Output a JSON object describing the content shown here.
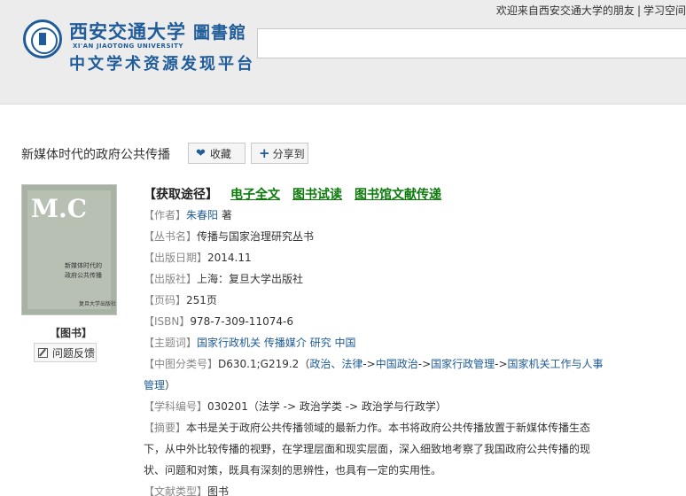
{
  "header": {
    "logo_cn": "西安交通大学",
    "logo_lib": "圖書館",
    "logo_en": "XI'AN JIAOTONG UNIVERSITY",
    "logo_sub": "中文学术资源发现平台",
    "welcome": "欢迎来自西安交通大学的朋友",
    "sep": "|",
    "link_more": "学习空间"
  },
  "book": {
    "title": "新媒体时代的政府公共传播",
    "fav_label": "收藏",
    "share_label": "分享到",
    "cover": {
      "mc": "M.C",
      "line1": "新媒体时代的",
      "line2": "政府公共传播",
      "pub": "复旦大学出版社"
    },
    "type_badge": "【图书】",
    "feedback_label": "问题反馈"
  },
  "access": {
    "label": "【获取途径】",
    "links": [
      "电子全文",
      "图书试读",
      "图书馆文献传递"
    ]
  },
  "details": {
    "author_label": "【作者】",
    "author": "朱春阳",
    "author_suffix": " 著",
    "series_label": "【丛书名】",
    "series": "传播与国家治理研究丛书",
    "date_label": "【出版日期】",
    "date": "2014.11",
    "publisher_label": "【出版社】",
    "publisher": "上海：复旦大学出版社",
    "pages_label": "【页码】",
    "pages": "251页",
    "isbn_label": "【ISBN】",
    "isbn": "978-7-309-11074-6",
    "subject_label": "【主题词】",
    "subjects": [
      "国家行政机关",
      "传播媒介",
      "研究",
      "中国"
    ],
    "clc_label": "【中图分类号】",
    "clc_code": "D630.1;G219.2",
    "clc_open": "（",
    "clc_path": [
      "政治、法律",
      "中国政治",
      "国家行政管理",
      "国家机关工作与人事管理"
    ],
    "clc_arrow": "->",
    "clc_close": "）",
    "discipline_label": "【学科编号】",
    "discipline": "030201（法学 -> 政治学类 -> 政治学与行政学）",
    "abstract_label": "【摘要】",
    "abstract": "本书是关于政府公共传播领域的最新力作。本书将政府公共传播放置于新媒体传播生态下，从中外比较传播的视野，在学理层面和现实层面，深入细致地考察了我国政府公共传播的现状、问题和对策，既具有深刻的思辨性，也具有一定的实用性。",
    "doctype_label": "【文献类型】",
    "doctype": "图书"
  }
}
